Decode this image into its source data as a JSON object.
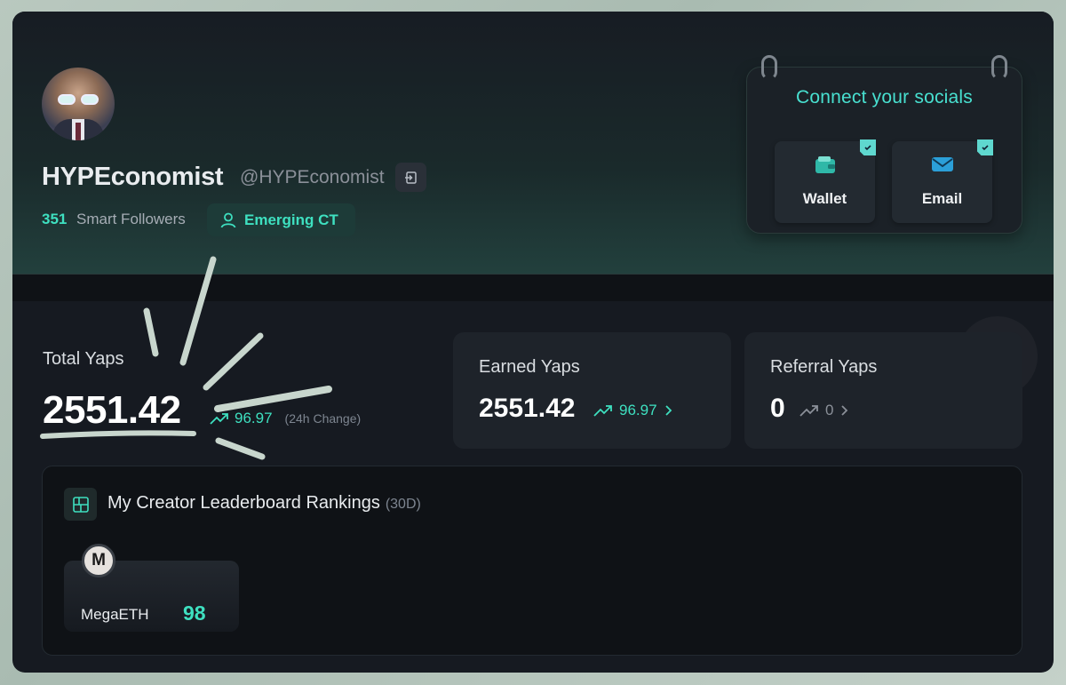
{
  "profile": {
    "display_name": "HYPEconomist",
    "handle": "@HYPEconomist",
    "smart_followers_count": "351",
    "smart_followers_label": "Smart Followers",
    "badge_label": "Emerging CT"
  },
  "socials": {
    "title": "Connect your socials",
    "items": [
      {
        "label": "Wallet",
        "icon": "wallet-icon",
        "connected": true
      },
      {
        "label": "Email",
        "icon": "mail-icon",
        "connected": true
      }
    ]
  },
  "total_yaps": {
    "label": "Total Yaps",
    "value": "2551.42",
    "change": "96.97",
    "change_label": "(24h Change)"
  },
  "earned_yaps": {
    "label": "Earned Yaps",
    "value": "2551.42",
    "change": "96.97"
  },
  "referral_yaps": {
    "label": "Referral Yaps",
    "value": "0",
    "change": "0"
  },
  "leaderboard": {
    "title": "My Creator Leaderboard Rankings",
    "period": "(30D)",
    "items": [
      {
        "name": "MegaETH",
        "score": "98",
        "logo_letter": "M"
      }
    ]
  },
  "colors": {
    "accent": "#3ee0c0",
    "background": "#161a21",
    "card": "#1e232a"
  }
}
